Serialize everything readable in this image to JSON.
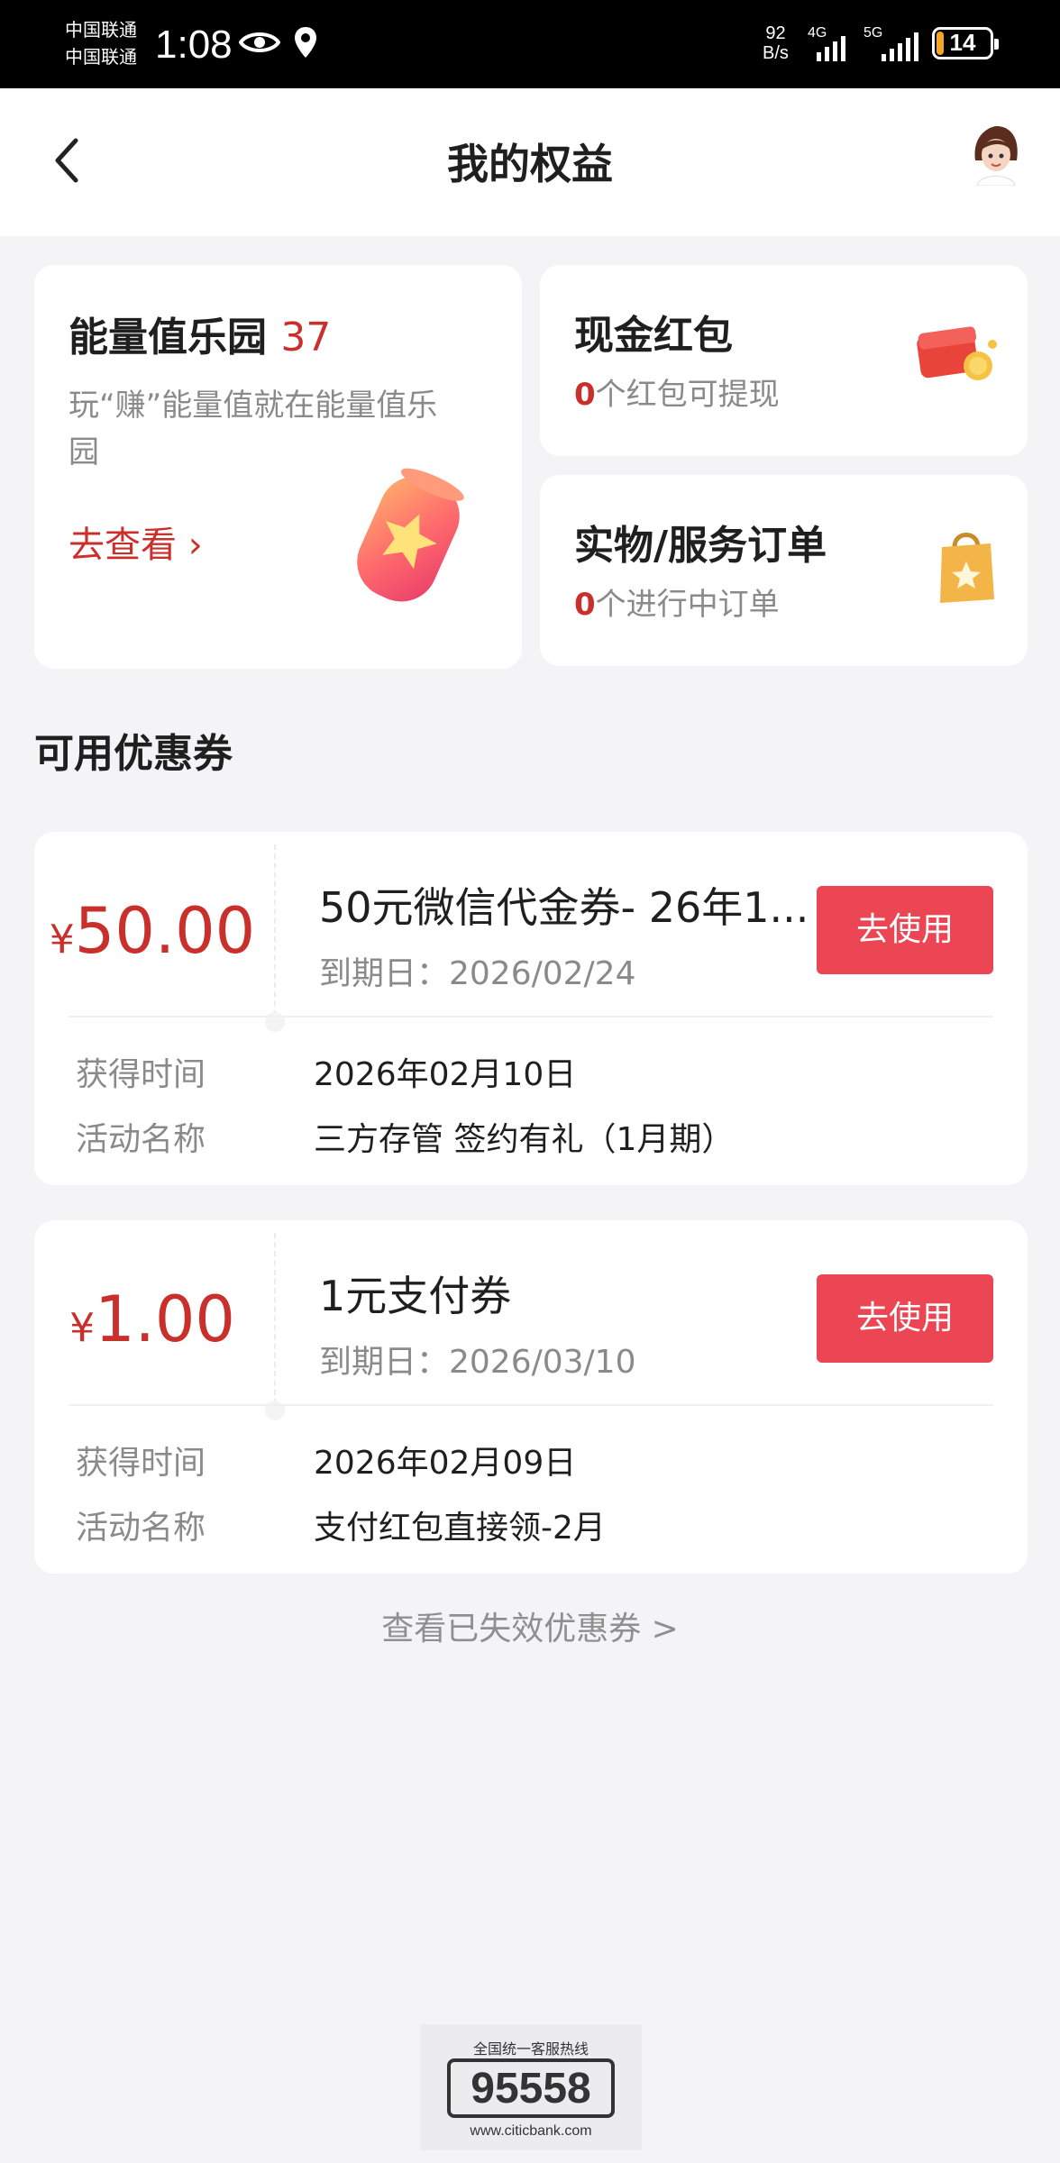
{
  "status_bar": {
    "carrier_1": "中国联通",
    "carrier_2": "中国联通",
    "time": "1:08",
    "net_speed_value": "92",
    "net_speed_unit": "B/s",
    "signal_1": "4G",
    "signal_2": "5G",
    "battery": "14",
    "battery_level": 0.14
  },
  "header": {
    "title": "我的权益"
  },
  "energy_card": {
    "title": "能量值乐园",
    "value": "37",
    "description": "玩“赚”能量值就在能量值乐园",
    "link": "去查看 ›"
  },
  "cash_card": {
    "title": "现金红包",
    "count": "0",
    "subtitle": "个红包可提现"
  },
  "order_card": {
    "title": "实物/服务订单",
    "count": "0",
    "subtitle": "个进行中订单"
  },
  "section_title": "可用优惠券",
  "coupons": [
    {
      "currency": "¥",
      "amount": "50.00",
      "name": "50元微信代金券- 26年1...",
      "expiry": "到期日：2026/02/24",
      "button": "去使用",
      "acquired_label": "获得时间",
      "acquired_value": "2026年02月10日",
      "activity_label": "活动名称",
      "activity_value": "三方存管 签约有礼（1月期）"
    },
    {
      "currency": "¥",
      "amount": "1.00",
      "name": "1元支付券",
      "expiry": "到期日：2026/03/10",
      "button": "去使用",
      "acquired_label": "获得时间",
      "acquired_value": "2026年02月09日",
      "activity_label": "活动名称",
      "activity_value": "支付红包直接领-2月"
    }
  ],
  "expired_link": "查看已失效优惠券 >",
  "hotline": {
    "caption": "全国统一客服热线",
    "number": "95558",
    "website": "www.citicbank.com"
  },
  "colors": {
    "accent_red": "#c9302c",
    "button_red": "#ec4655",
    "background": "#f4f4f6"
  }
}
